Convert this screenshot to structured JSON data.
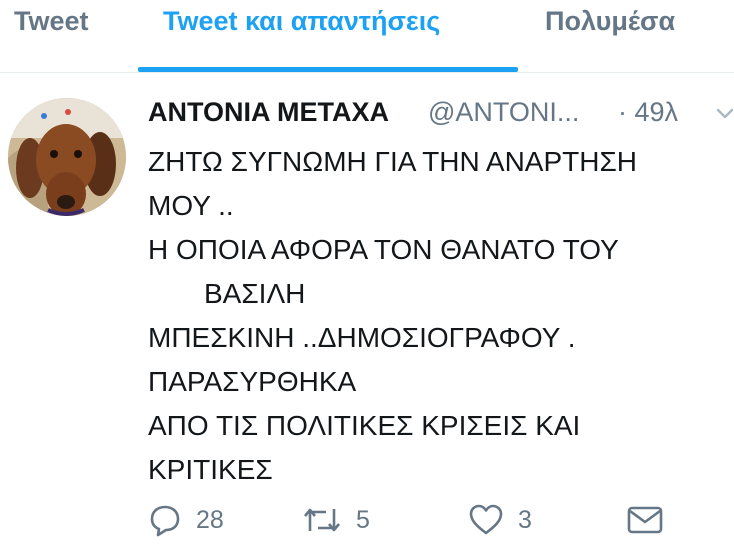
{
  "tabs": [
    {
      "label": "Tweet"
    },
    {
      "label": "Tweet και απαντήσεις"
    },
    {
      "label": "Πολυμέσα"
    }
  ],
  "active_tab_index": 1,
  "tweet": {
    "display_name": "ANTONIA METAXA",
    "handle": "@ANTONI...",
    "time": "· 49λ",
    "lines": [
      "ΖΗΤΩ  ΣΥΓΝΩΜΗ ΓΙΑ ΤΗΝ ΑΝΑΡΤΗΣΗ",
      "ΜΟΥ ..",
      "Η ΟΠΟΙΑ ΑΦΟΡΑ ΤΟΝ ΘΑΝΑΤΟ ΤΟΥ",
      "ΒΑΣΙΛΗ",
      "ΜΠΕΣΚΙΝΗ ..ΔΗΜΟΣΙΟΓΡΑΦΟΥ .",
      "ΠΑΡΑΣΥΡΘΗΚΑ",
      "ΑΠΟ ΤΙΣ ΠΟΛΙΤΙΚΕΣ ΚΡΙΣΕΙΣ ΚΑΙ",
      "ΚΡΙΤΙΚΕΣ"
    ],
    "reply_count": "28",
    "retweet_count": "5",
    "like_count": "3",
    "icons": {
      "reply": "reply-icon",
      "retweet": "retweet-icon",
      "like": "heart-icon",
      "message": "envelope-icon",
      "caret": "chevron-down-icon",
      "avatar": "dog-avatar"
    }
  },
  "colors": {
    "accent": "#1da1f2",
    "text": "#14171a",
    "muted": "#657786",
    "divider": "#e6ecf0"
  }
}
